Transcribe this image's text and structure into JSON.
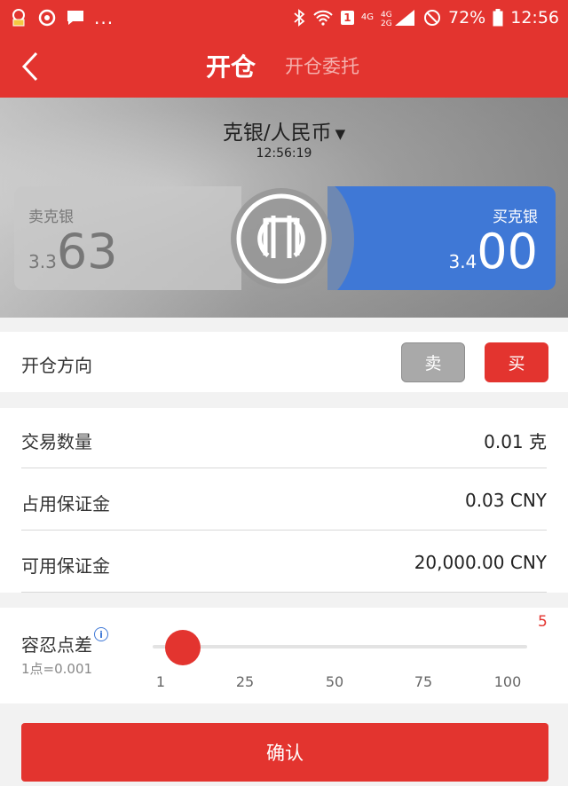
{
  "status_bar": {
    "battery": "72%",
    "time": "12:56",
    "network_top": "4G",
    "network_stack": "4G 2G",
    "sim_badge": "1",
    "dots": "..."
  },
  "header": {
    "title": "开仓",
    "tab2": "开仓委托"
  },
  "quote": {
    "symbol": "克银/人民币",
    "time": "12:56:19",
    "sell_label": "卖克银",
    "sell_price_prefix": "3.3",
    "sell_price_main": "63",
    "buy_label": "买克银",
    "buy_price_prefix": "3.4",
    "buy_price_main": "00"
  },
  "direction": {
    "label": "开仓方向",
    "sell": "卖",
    "buy": "买",
    "selected": "买"
  },
  "details": {
    "quantity_label": "交易数量",
    "quantity_value": "0.01 克",
    "margin_used_label": "占用保证金",
    "margin_used_value": "0.03 CNY",
    "margin_available_label": "可用保证金",
    "margin_available_value": "20,000.00 CNY"
  },
  "tolerance": {
    "label": "容忍点差",
    "sub": "1点=0.001",
    "value": "5",
    "ticks": [
      "1",
      "25",
      "50",
      "75",
      "100"
    ]
  },
  "confirm": "确认",
  "colors": {
    "brand_red": "#e3342f",
    "buy_blue": "#3f78d6",
    "sell_gray": "#a9a9a9"
  }
}
